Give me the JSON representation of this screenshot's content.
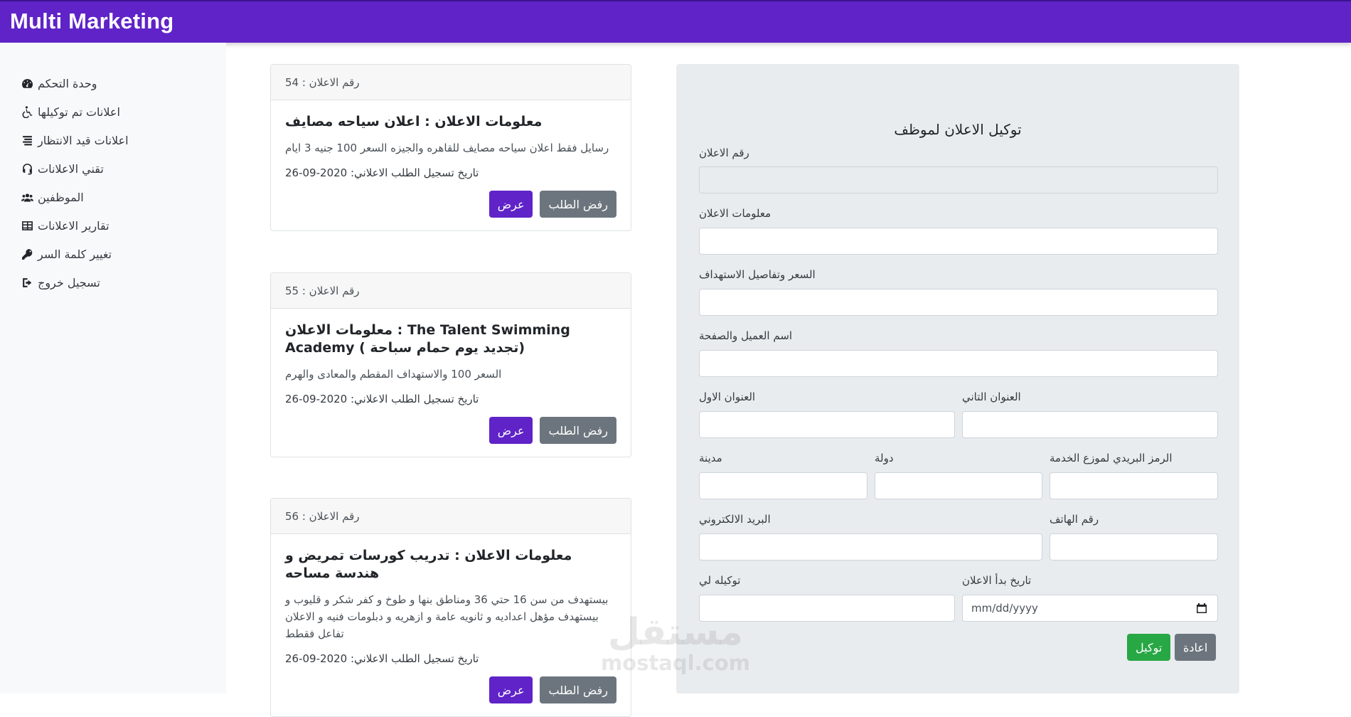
{
  "app": {
    "brand": "Multi Marketing"
  },
  "sidebar": {
    "items": [
      {
        "label": "وحدة التحكم",
        "icon": "dashboard-icon"
      },
      {
        "label": "اعلانات تم توكيلها",
        "icon": "wheelchair-icon"
      },
      {
        "label": "اعلانات قيد الانتظار",
        "icon": "list-icon"
      },
      {
        "label": "تقني الاعلانات",
        "icon": "headset-icon"
      },
      {
        "label": "الموظفين",
        "icon": "users-icon"
      },
      {
        "label": "تقارير الاعلانات",
        "icon": "table-icon"
      },
      {
        "label": "تغيير كلمة السر",
        "icon": "key-icon"
      },
      {
        "label": "تسجيل خروج",
        "icon": "logout-icon"
      }
    ]
  },
  "ads": [
    {
      "header": "رقم الاعلان : 54",
      "title": "معلومات الاعلان : اعلان سياحه مصايف",
      "text": "رسايل فقط اعلان سياحه مصايف للقاهره والجيزه السعر 100 جنيه 3 ايام",
      "date": "تاريخ تسجيل الطلب الاعلاني: 2020-09-26",
      "view_label": "عرض",
      "reject_label": "رفض الطلب"
    },
    {
      "header": "رقم الاعلان : 55",
      "title": "معلومات الاعلان : The Talent Swimming Academy ( تجديد يوم حمام سباحة)",
      "text": "السعر 100 والاستهداف المقطم والمعادى والهرم",
      "date": "تاريخ تسجيل الطلب الاعلاني: 2020-09-26",
      "view_label": "عرض",
      "reject_label": "رفض الطلب"
    },
    {
      "header": "رقم الاعلان : 56",
      "title": "معلومات الاعلان : تدريب كورسات تمريض و هندسة مساحه",
      "text": "بيستهدف من سن 16 حتي 36 ومناطق بنها و طوخ و كفر شكر و قليوب و بيستهدف مؤهل اعداديه و ثانويه عامة و ازهريه و دبلومات فنيه و الاعلان تفاعل فقطط",
      "date": "تاريخ تسجيل الطلب الاعلاني: 2020-09-26",
      "view_label": "عرض",
      "reject_label": "رفض الطلب"
    }
  ],
  "form": {
    "title": "توكيل الاعلان لموظف",
    "ad_number_label": "رقم الاعلان",
    "ad_info_label": "معلومات الاعلان",
    "price_label": "السعر وتفاصيل الاستهداف",
    "client_label": "اسم العميل والصفحة",
    "address1_label": "العنوان الاول",
    "address2_label": "العنوان التاني",
    "city_label": "مدينة",
    "country_label": "دولة",
    "zip_label": "الرمز البريدي لموزع الخدمة",
    "email_label": "البريد الالكتروني",
    "phone_label": "رقم الهاتف",
    "assign_label": "توكيله لي",
    "start_date_label": "تاريخ بدأ الاعلان",
    "date_placeholder": "mm/dd/yyyy",
    "submit_label": "توكيل",
    "reset_label": "اعادة"
  },
  "watermark": {
    "ar": "مستقل",
    "en": "mostaql.com"
  }
}
